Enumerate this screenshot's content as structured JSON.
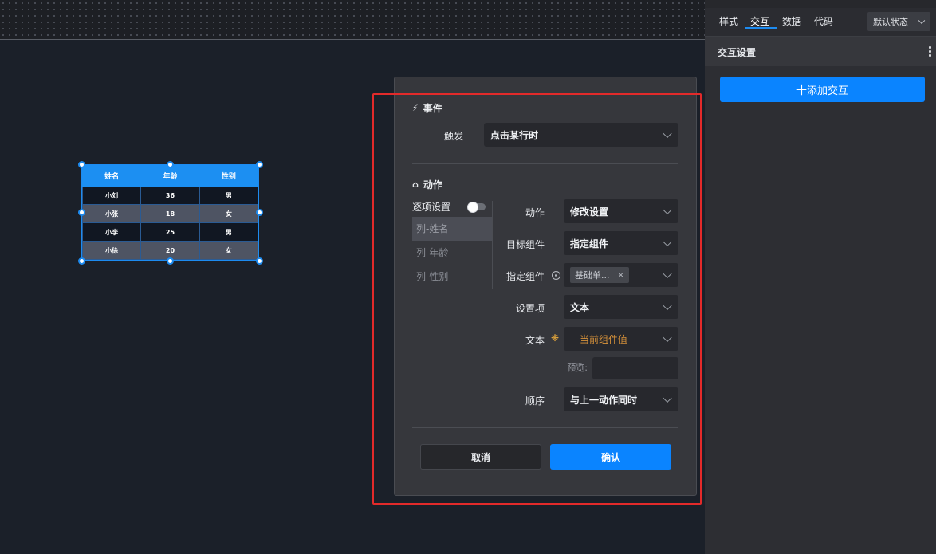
{
  "table": {
    "headers": [
      "姓名",
      "年龄",
      "性别"
    ],
    "rows": [
      [
        "小刘",
        "36",
        "男"
      ],
      [
        "小张",
        "18",
        "女"
      ],
      [
        "小李",
        "25",
        "男"
      ],
      [
        "小徐",
        "20",
        "女"
      ]
    ]
  },
  "dialog": {
    "event_section": {
      "title": "事件",
      "icon": "lightning-icon"
    },
    "trigger": {
      "label": "触发",
      "value": "点击某行时"
    },
    "action_section": {
      "title": "动作",
      "icon": "home-icon"
    },
    "per_item_setting": {
      "label": "逐项设置",
      "enabled": false
    },
    "columns": [
      "列-姓名",
      "列-年龄",
      "列-性别"
    ],
    "active_column": "列-姓名",
    "fields": {
      "action": {
        "label": "动作",
        "value": "修改设置"
      },
      "target": {
        "label": "目标组件",
        "value": "指定组件"
      },
      "specified": {
        "label": "指定组件",
        "tag": "基础单...",
        "tag_close": "×",
        "icon": "locate-icon"
      },
      "setting": {
        "label": "设置项",
        "value": "文本"
      },
      "text": {
        "label": "文本",
        "value": "当前组件值",
        "icon": "sparkle-icon"
      },
      "preview": {
        "label": "预览:",
        "value": ""
      },
      "order": {
        "label": "顺序",
        "value": "与上一动作同时"
      }
    },
    "buttons": {
      "cancel": "取消",
      "confirm": "确认"
    }
  },
  "right_panel": {
    "tabs": [
      "样式",
      "交互",
      "数据",
      "代码"
    ],
    "active_tab": "交互",
    "state_select": "默认状态",
    "header": "交互设置",
    "add_button": "十添加交互"
  },
  "colors": {
    "accent": "#0a84ff",
    "table_header": "#1c8ff2",
    "highlight_frame": "#e32a2a",
    "orange": "#d7923a"
  }
}
